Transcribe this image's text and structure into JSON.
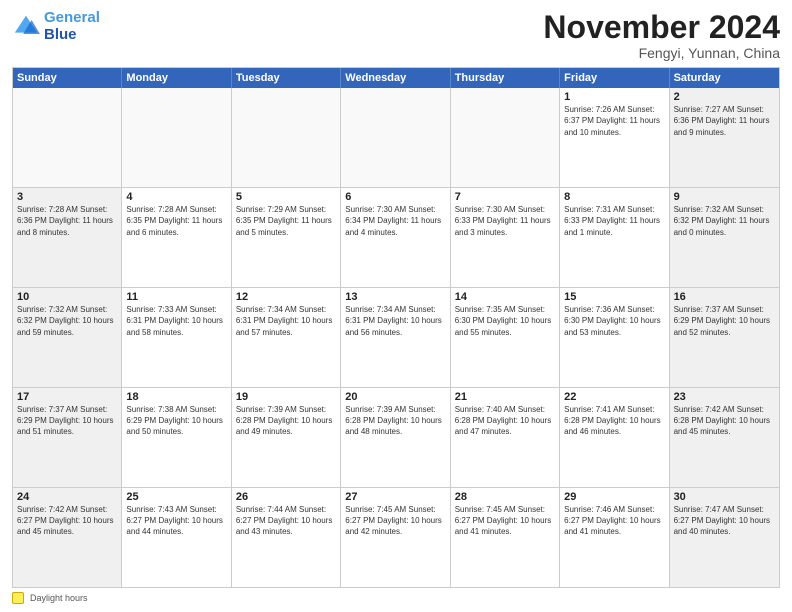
{
  "logo": {
    "line1": "General",
    "line2": "Blue"
  },
  "title": "November 2024",
  "subtitle": "Fengyi, Yunnan, China",
  "weekdays": [
    "Sunday",
    "Monday",
    "Tuesday",
    "Wednesday",
    "Thursday",
    "Friday",
    "Saturday"
  ],
  "footer": {
    "legend_label": "Daylight hours"
  },
  "weeks": [
    [
      {
        "day": "",
        "empty": true
      },
      {
        "day": "",
        "empty": true
      },
      {
        "day": "",
        "empty": true
      },
      {
        "day": "",
        "empty": true
      },
      {
        "day": "",
        "empty": true
      },
      {
        "day": "1",
        "info": "Sunrise: 7:26 AM\nSunset: 6:37 PM\nDaylight: 11 hours and 10 minutes.",
        "shaded": false
      },
      {
        "day": "2",
        "info": "Sunrise: 7:27 AM\nSunset: 6:36 PM\nDaylight: 11 hours and 9 minutes.",
        "shaded": true
      }
    ],
    [
      {
        "day": "3",
        "info": "Sunrise: 7:28 AM\nSunset: 6:36 PM\nDaylight: 11 hours and 8 minutes.",
        "shaded": true
      },
      {
        "day": "4",
        "info": "Sunrise: 7:28 AM\nSunset: 6:35 PM\nDaylight: 11 hours and 6 minutes.",
        "shaded": false
      },
      {
        "day": "5",
        "info": "Sunrise: 7:29 AM\nSunset: 6:35 PM\nDaylight: 11 hours and 5 minutes.",
        "shaded": false
      },
      {
        "day": "6",
        "info": "Sunrise: 7:30 AM\nSunset: 6:34 PM\nDaylight: 11 hours and 4 minutes.",
        "shaded": false
      },
      {
        "day": "7",
        "info": "Sunrise: 7:30 AM\nSunset: 6:33 PM\nDaylight: 11 hours and 3 minutes.",
        "shaded": false
      },
      {
        "day": "8",
        "info": "Sunrise: 7:31 AM\nSunset: 6:33 PM\nDaylight: 11 hours and 1 minute.",
        "shaded": false
      },
      {
        "day": "9",
        "info": "Sunrise: 7:32 AM\nSunset: 6:32 PM\nDaylight: 11 hours and 0 minutes.",
        "shaded": true
      }
    ],
    [
      {
        "day": "10",
        "info": "Sunrise: 7:32 AM\nSunset: 6:32 PM\nDaylight: 10 hours and 59 minutes.",
        "shaded": true
      },
      {
        "day": "11",
        "info": "Sunrise: 7:33 AM\nSunset: 6:31 PM\nDaylight: 10 hours and 58 minutes.",
        "shaded": false
      },
      {
        "day": "12",
        "info": "Sunrise: 7:34 AM\nSunset: 6:31 PM\nDaylight: 10 hours and 57 minutes.",
        "shaded": false
      },
      {
        "day": "13",
        "info": "Sunrise: 7:34 AM\nSunset: 6:31 PM\nDaylight: 10 hours and 56 minutes.",
        "shaded": false
      },
      {
        "day": "14",
        "info": "Sunrise: 7:35 AM\nSunset: 6:30 PM\nDaylight: 10 hours and 55 minutes.",
        "shaded": false
      },
      {
        "day": "15",
        "info": "Sunrise: 7:36 AM\nSunset: 6:30 PM\nDaylight: 10 hours and 53 minutes.",
        "shaded": false
      },
      {
        "day": "16",
        "info": "Sunrise: 7:37 AM\nSunset: 6:29 PM\nDaylight: 10 hours and 52 minutes.",
        "shaded": true
      }
    ],
    [
      {
        "day": "17",
        "info": "Sunrise: 7:37 AM\nSunset: 6:29 PM\nDaylight: 10 hours and 51 minutes.",
        "shaded": true
      },
      {
        "day": "18",
        "info": "Sunrise: 7:38 AM\nSunset: 6:29 PM\nDaylight: 10 hours and 50 minutes.",
        "shaded": false
      },
      {
        "day": "19",
        "info": "Sunrise: 7:39 AM\nSunset: 6:28 PM\nDaylight: 10 hours and 49 minutes.",
        "shaded": false
      },
      {
        "day": "20",
        "info": "Sunrise: 7:39 AM\nSunset: 6:28 PM\nDaylight: 10 hours and 48 minutes.",
        "shaded": false
      },
      {
        "day": "21",
        "info": "Sunrise: 7:40 AM\nSunset: 6:28 PM\nDaylight: 10 hours and 47 minutes.",
        "shaded": false
      },
      {
        "day": "22",
        "info": "Sunrise: 7:41 AM\nSunset: 6:28 PM\nDaylight: 10 hours and 46 minutes.",
        "shaded": false
      },
      {
        "day": "23",
        "info": "Sunrise: 7:42 AM\nSunset: 6:28 PM\nDaylight: 10 hours and 45 minutes.",
        "shaded": true
      }
    ],
    [
      {
        "day": "24",
        "info": "Sunrise: 7:42 AM\nSunset: 6:27 PM\nDaylight: 10 hours and 45 minutes.",
        "shaded": true
      },
      {
        "day": "25",
        "info": "Sunrise: 7:43 AM\nSunset: 6:27 PM\nDaylight: 10 hours and 44 minutes.",
        "shaded": false
      },
      {
        "day": "26",
        "info": "Sunrise: 7:44 AM\nSunset: 6:27 PM\nDaylight: 10 hours and 43 minutes.",
        "shaded": false
      },
      {
        "day": "27",
        "info": "Sunrise: 7:45 AM\nSunset: 6:27 PM\nDaylight: 10 hours and 42 minutes.",
        "shaded": false
      },
      {
        "day": "28",
        "info": "Sunrise: 7:45 AM\nSunset: 6:27 PM\nDaylight: 10 hours and 41 minutes.",
        "shaded": false
      },
      {
        "day": "29",
        "info": "Sunrise: 7:46 AM\nSunset: 6:27 PM\nDaylight: 10 hours and 41 minutes.",
        "shaded": false
      },
      {
        "day": "30",
        "info": "Sunrise: 7:47 AM\nSunset: 6:27 PM\nDaylight: 10 hours and 40 minutes.",
        "shaded": true
      }
    ]
  ]
}
